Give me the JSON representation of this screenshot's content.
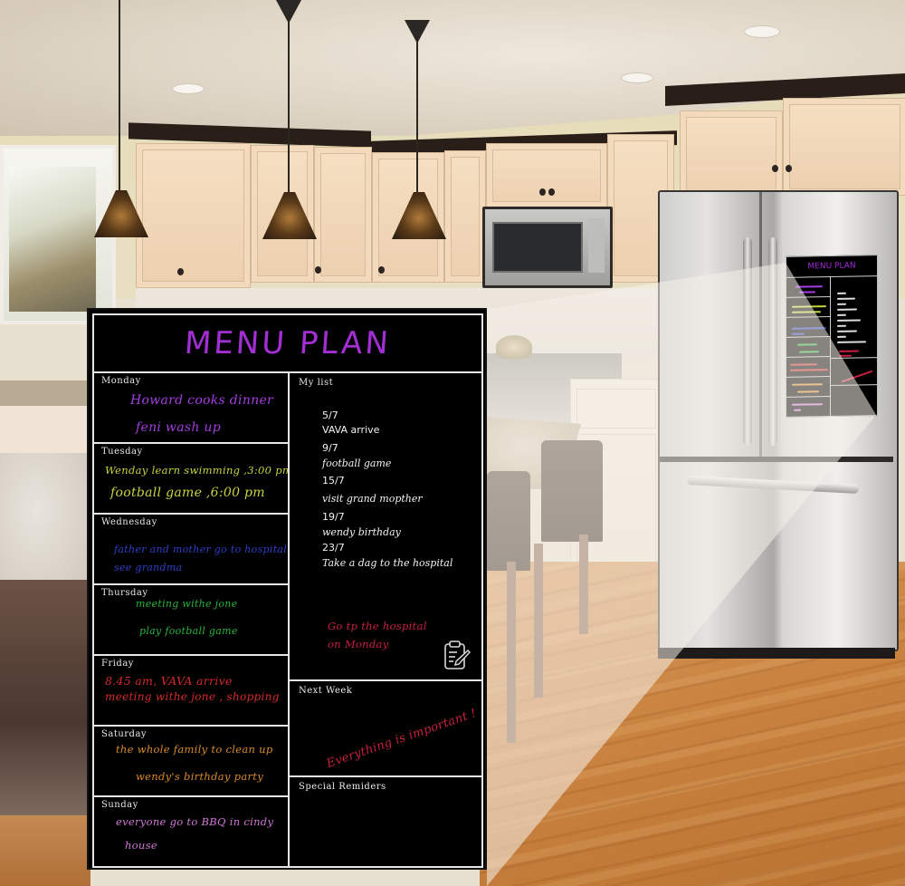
{
  "board": {
    "title": "MENU PLAN",
    "title_color": "#a32fd4",
    "days": [
      {
        "label": "Monday",
        "color": "#a33de0",
        "notes": [
          "Howard cooks dinner",
          "feni wash up"
        ]
      },
      {
        "label": "Tuesday",
        "color": "#c7d43c",
        "notes": [
          "Wenday learn swimming ,3:00 pm",
          "football game ,6:00 pm"
        ]
      },
      {
        "label": "Wednesday",
        "color": "#2f3fc8",
        "notes": [
          "father and mother go to hospital",
          "see grandma"
        ]
      },
      {
        "label": "Thursday",
        "color": "#27b43c",
        "notes": [
          "meeting withe jone",
          "play football game"
        ]
      },
      {
        "label": "Friday",
        "color": "#d42a2a",
        "notes": [
          "8.45 am, VAVA arrive",
          "meeting withe jone ,  shopping"
        ]
      },
      {
        "label": "Saturday",
        "color": "#d98c2a",
        "notes": [
          "the whole family to clean up",
          "wendy's birthday party"
        ]
      },
      {
        "label": "Sunday",
        "color": "#d176d6",
        "notes": [
          "everyone go to  BBQ  in cindy",
          "house"
        ]
      }
    ],
    "my_list": {
      "label": "My list",
      "entries": [
        {
          "date": "5/7",
          "text": "VAVA  arrive"
        },
        {
          "date": "9/7",
          "text": "football  game"
        },
        {
          "date": "15/7",
          "text": "visit grand mopther"
        },
        {
          "date": "19/7",
          "text": "wendy birthday"
        },
        {
          "date": "23/7",
          "text": "Take a dag to the hospital"
        }
      ],
      "reminder_color": "#c8203e",
      "reminder": [
        "Go tp the hospital",
        "on Monday"
      ],
      "icon": "clipboard-pen-icon"
    },
    "next_week": {
      "label": "Next Week",
      "note": "Everything is important !",
      "note_color": "#c8203e"
    },
    "special_reminders": {
      "label": "Special Remiders"
    }
  },
  "fridge_magnet": {
    "title": "MENU PLAN"
  }
}
